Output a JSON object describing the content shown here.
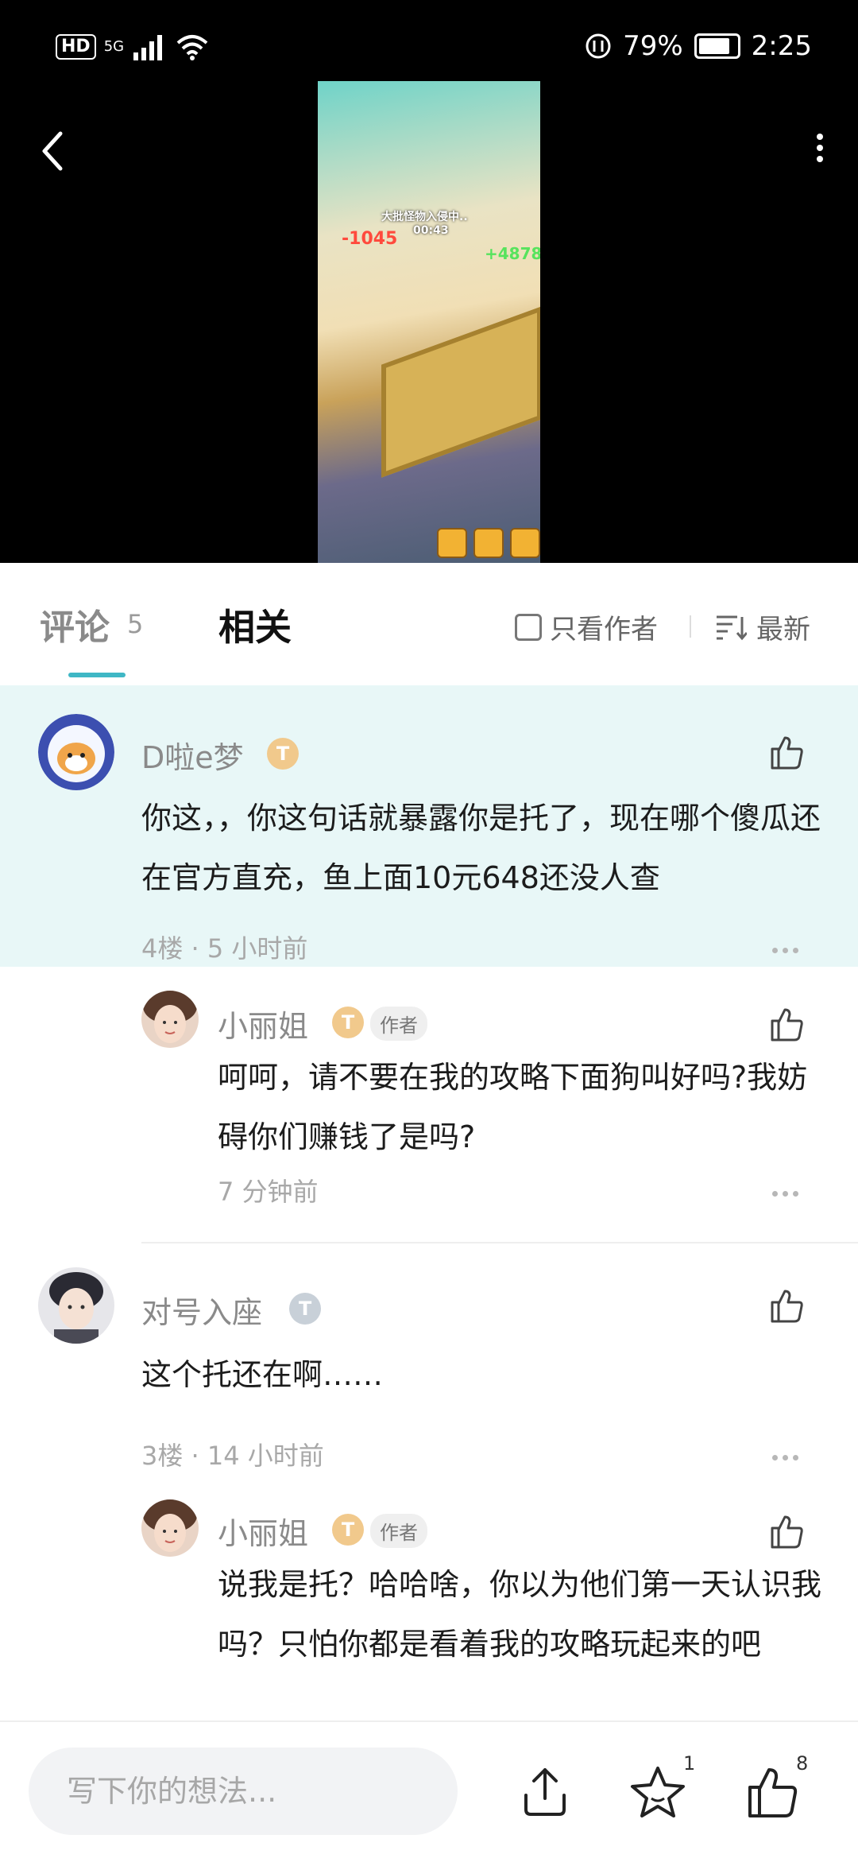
{
  "status": {
    "hd": "HD",
    "network": "5G",
    "battery": "79%",
    "time": "2:25"
  },
  "video": {
    "alert": "大批怪物入侵中..",
    "timer": "00:43",
    "damage_red": "-1045",
    "damage_green": "+4878"
  },
  "tabs": {
    "comments_label": "评论",
    "comments_count": "5",
    "related_label": "相关",
    "only_author": "只看作者",
    "sort": "最新"
  },
  "comments": [
    {
      "user": "D啦e梦",
      "badge": "T",
      "text": "你这，，你这句话就暴露你是托了，现在哪个傻瓜还在官方直充，鱼上面10元648还没人查",
      "meta": "4楼 · 5 小时前",
      "reply": {
        "user": "小丽姐",
        "badge": "T",
        "author_tag": "作者",
        "text": "呵呵，请不要在我的攻略下面狗叫好吗?我妨碍你们赚钱了是吗?",
        "meta": "7 分钟前"
      }
    },
    {
      "user": "对号入座",
      "badge": "T",
      "text": "这个托还在啊……",
      "meta": "3楼 · 14 小时前",
      "reply": {
        "user": "小丽姐",
        "badge": "T",
        "author_tag": "作者",
        "text": "说我是托？哈哈啥，你以为他们第一天认识我吗？只怕你都是看着我的攻略玩起来的吧"
      }
    }
  ],
  "bottom": {
    "placeholder": "写下你的想法...",
    "favorite_count": "1",
    "like_count": "8"
  },
  "colors": {
    "accent": "#3fb7c5",
    "highlight_bg": "#e8f7f7"
  }
}
